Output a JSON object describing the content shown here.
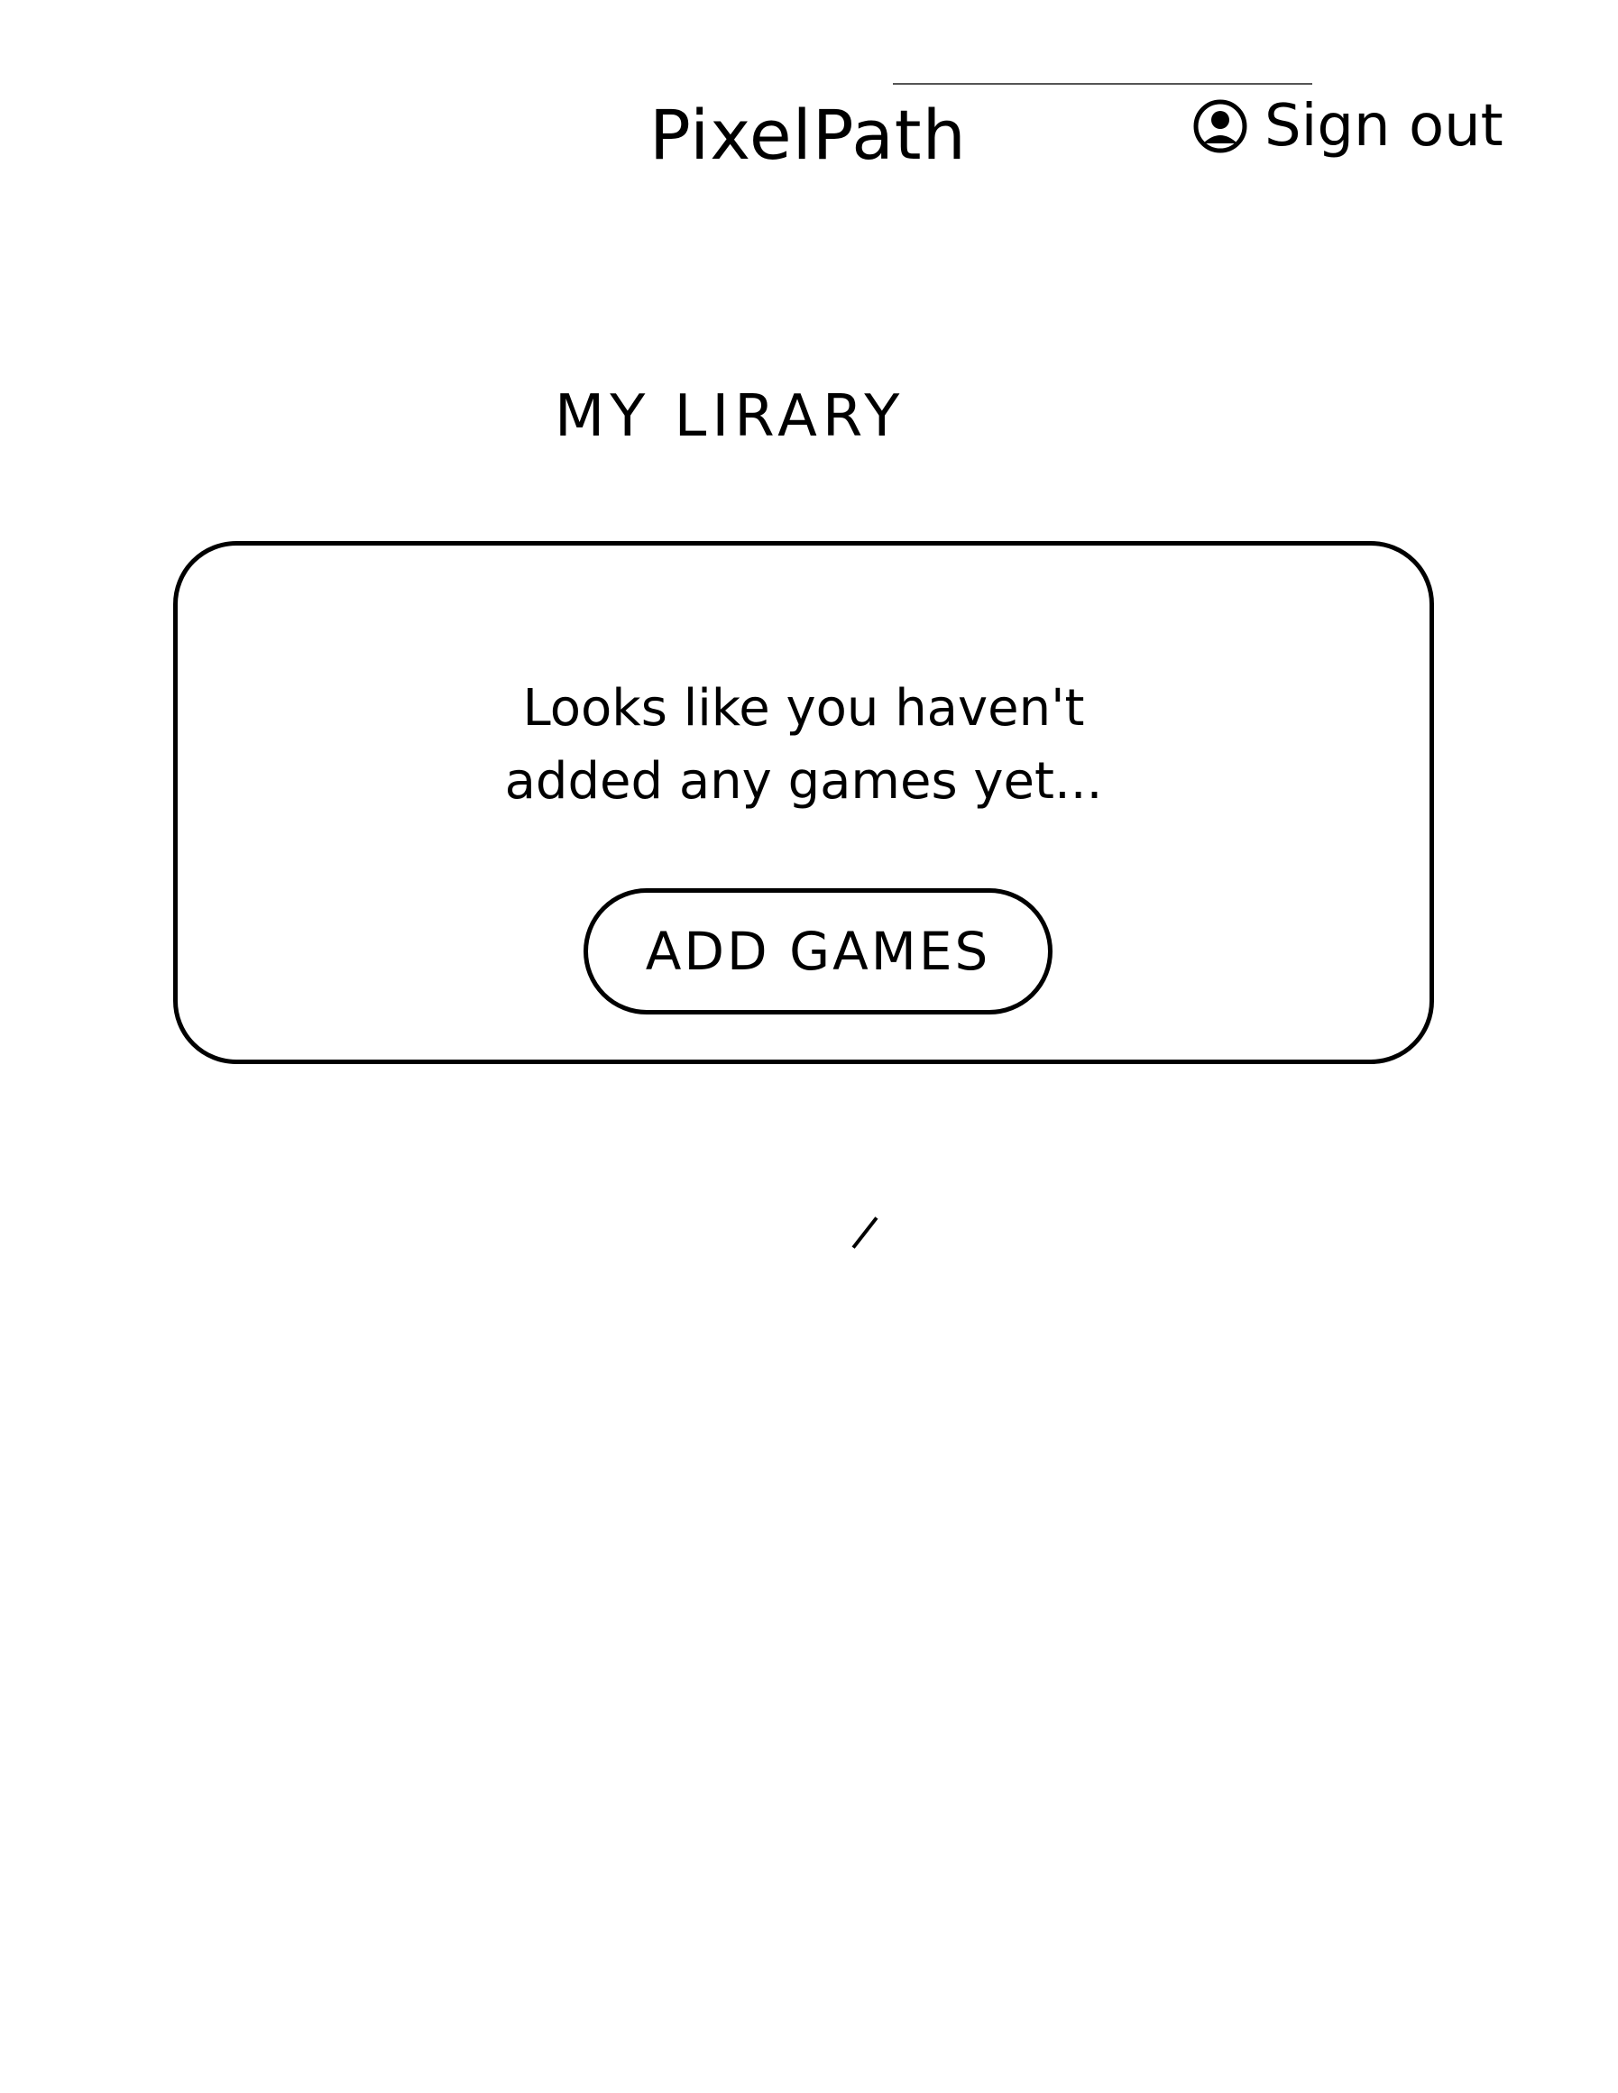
{
  "header": {
    "app_title": "PixelPath",
    "signout_label": "Sign out",
    "account_icon": "account-icon"
  },
  "library": {
    "title": "MY LIRARY",
    "empty_message_line1": "Looks like you haven't",
    "empty_message_line2": "added any games yet...",
    "add_games_label": "ADD GAMES"
  },
  "colors": {
    "ink": "#000000",
    "background": "#ffffff"
  }
}
